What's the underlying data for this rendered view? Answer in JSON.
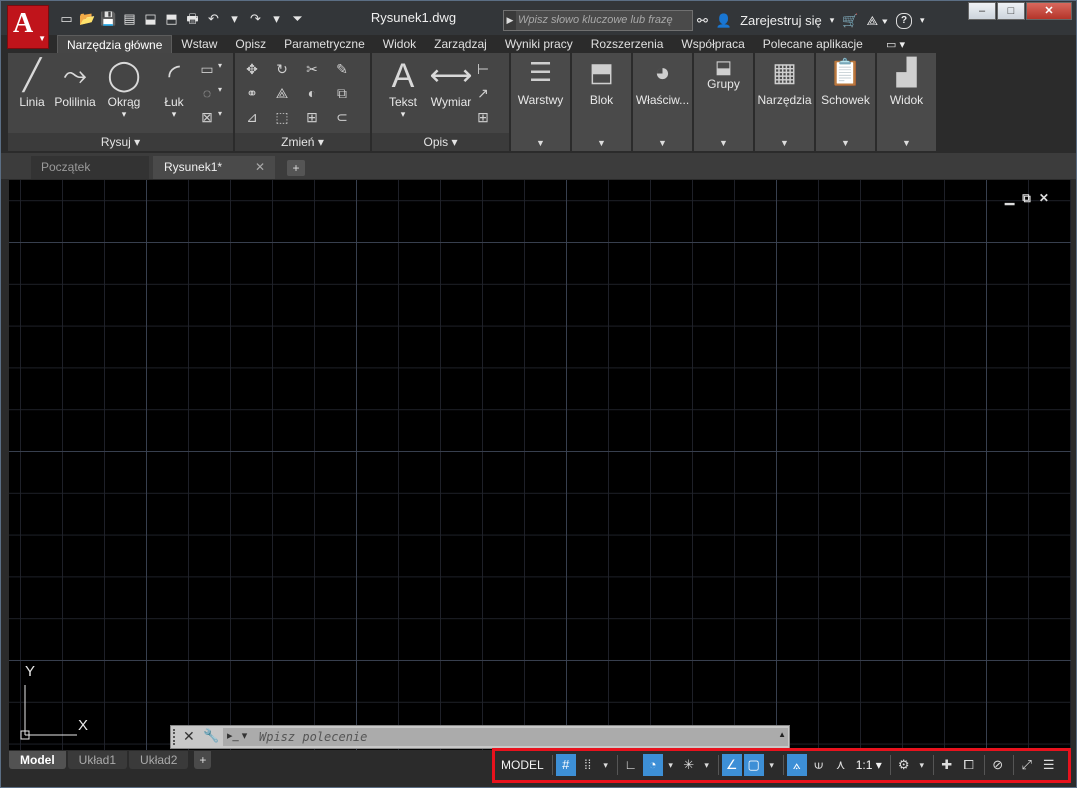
{
  "title_bar": {
    "app_menu_letter": "A",
    "qat_icons": [
      "new-icon",
      "open-icon",
      "save-icon",
      "save-as-icon",
      "open-web-icon",
      "save-web-icon",
      "plot-icon",
      "undo-icon",
      "undo-dropdown-icon",
      "redo-icon",
      "redo-dropdown-icon",
      "qat-customize-icon"
    ],
    "qat_glyphs": [
      "▭",
      "📂",
      "💾",
      "▤",
      "⬓",
      "⬒",
      "🖶",
      "↶",
      "▾",
      "↷",
      "▾",
      "⏷"
    ],
    "document_title": "Rysunek1.dwg",
    "search_placeholder": "Wpisz słowo kluczowe lub frazę",
    "sign_in_label": "Zarejestruj się",
    "window_controls": [
      "–",
      "□",
      "✕"
    ]
  },
  "ribbon_tabs": [
    "Narzędzia główne",
    "Wstaw",
    "Opisz",
    "Parametryczne",
    "Widok",
    "Zarządzaj",
    "Wyniki pracy",
    "Rozszerzenia",
    "Współpraca",
    "Polecane aplikacje"
  ],
  "active_tab_index": 0,
  "panels": {
    "draw": {
      "footer": "Rysuj ▾",
      "big_tools": [
        {
          "label": "Linia",
          "glyph": "╱"
        },
        {
          "label": "Polilinia",
          "glyph": "⤳"
        },
        {
          "label": "Okrąg",
          "glyph": "◯"
        },
        {
          "label": "Łuk",
          "glyph": "◜"
        }
      ],
      "small_tools": [
        "▭",
        "◌",
        "⊠"
      ]
    },
    "modify": {
      "footer": "Zmień ▾",
      "small_tools": [
        "✥",
        "↻",
        "✂",
        "✎",
        "⚭",
        "⟁",
        "◐",
        "⧉",
        "⊿",
        "⬚",
        "⊞",
        "⊂"
      ]
    },
    "annotate": {
      "footer": "Opis ▾",
      "big_tools": [
        {
          "label": "Tekst",
          "glyph": "A"
        },
        {
          "label": "Wymiar",
          "glyph": "⟷"
        }
      ],
      "small_tools": [
        "⊢",
        "↗",
        "⊞"
      ]
    },
    "tall_tools": [
      {
        "label": "Warstwy",
        "glyph": "☰"
      },
      {
        "label": "Blok",
        "glyph": "⬒"
      },
      {
        "label": "Właściw...",
        "glyph": "◕"
      },
      {
        "label": "Grupy",
        "glyph": "⬓"
      },
      {
        "label": "Narzędzia",
        "glyph": "▦"
      },
      {
        "label": "Schowek",
        "glyph": "📋"
      },
      {
        "label": "Widok",
        "glyph": "▟"
      }
    ]
  },
  "file_tabs": {
    "start": "Początek",
    "current": "Rysunek1*",
    "close_glyph": "✕",
    "new_glyph": "+"
  },
  "viewport_controls": [
    "▁",
    "⧉",
    "✕"
  ],
  "ucs": {
    "x_label": "X",
    "y_label": "Y"
  },
  "command_line": {
    "close_glyph": "✕",
    "customize_glyph": "🔧",
    "prompt_glyph": "▸_ ▾",
    "placeholder": "Wpisz polecenie",
    "history_glyph": "▲"
  },
  "layout_tabs": [
    "Model",
    "Układ1",
    "Układ2"
  ],
  "layout_add": "+",
  "status_bar": {
    "model_label": "MODEL",
    "scale_label": "1:1 ▾",
    "items": [
      {
        "name": "grid-display-button",
        "glyph": "#",
        "on": true
      },
      {
        "name": "snap-mode-button",
        "glyph": "⁞⁞",
        "on": false
      },
      {
        "name": "snap-dropdown",
        "glyph": "▾",
        "on": false,
        "dd": true
      },
      {
        "name": "ortho-mode-button",
        "glyph": "∟",
        "on": false
      },
      {
        "name": "polar-tracking-button",
        "glyph": "◔",
        "on": true
      },
      {
        "name": "polar-dropdown",
        "glyph": "▾",
        "on": false,
        "dd": true
      },
      {
        "name": "isometric-drafting-button",
        "glyph": "✳",
        "on": false
      },
      {
        "name": "isometric-dropdown",
        "glyph": "▾",
        "on": false,
        "dd": true
      },
      {
        "name": "object-snap-tracking-button",
        "glyph": "∠",
        "on": true
      },
      {
        "name": "object-snap-button",
        "glyph": "▢",
        "on": true
      },
      {
        "name": "object-snap-dropdown",
        "glyph": "▾",
        "on": false,
        "dd": true
      },
      {
        "name": "annotation-visibility-button",
        "glyph": "⟑",
        "on": true
      },
      {
        "name": "auto-scale-button",
        "glyph": "⟒",
        "on": false
      },
      {
        "name": "annotation-scale-icon-button",
        "glyph": "⋏",
        "on": false
      }
    ],
    "trailing_items": [
      {
        "name": "workspace-switch-button",
        "glyph": "⚙"
      },
      {
        "name": "workspace-dropdown",
        "glyph": "▾"
      },
      {
        "name": "annotation-monitor-button",
        "glyph": "✚"
      },
      {
        "name": "units-button",
        "glyph": "⧠"
      },
      {
        "name": "isolate-objects-button",
        "glyph": "⊘"
      },
      {
        "name": "clean-screen-button",
        "glyph": "⤢"
      },
      {
        "name": "customization-button",
        "glyph": "☰"
      }
    ]
  }
}
